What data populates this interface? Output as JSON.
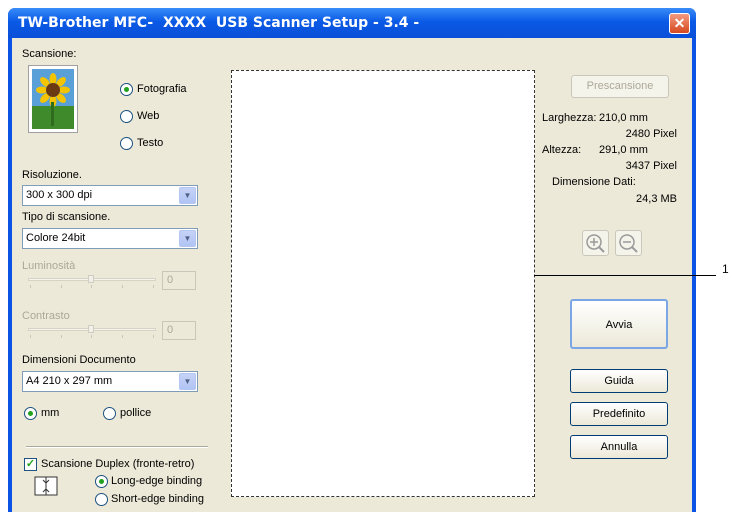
{
  "window": {
    "title": "TW-Brother MFC-  XXXX  USB Scanner Setup - 3.4 -",
    "close_glyph": "✕"
  },
  "scan": {
    "label": "Scansione:",
    "thumbnail_icon": "sunflower-photo-icon",
    "options": [
      {
        "label": "Fotografia",
        "selected": true
      },
      {
        "label": "Web",
        "selected": false
      },
      {
        "label": "Testo",
        "selected": false
      }
    ]
  },
  "resolution": {
    "label": "Risoluzione.",
    "value": "300 x 300 dpi"
  },
  "scan_type": {
    "label": "Tipo di scansione.",
    "value": "Colore 24bit"
  },
  "brightness": {
    "label": "Luminosità",
    "value": "0"
  },
  "contrast": {
    "label": "Contrasto",
    "value": "0"
  },
  "doc_size": {
    "label": "Dimensioni Documento",
    "value": "A4 210 x 297 mm"
  },
  "units": [
    {
      "label": "mm",
      "selected": true
    },
    {
      "label": "pollice",
      "selected": false
    }
  ],
  "duplex": {
    "label": "Scansione Duplex (fronte-retro)",
    "checked": true,
    "options": [
      {
        "label": "Long-edge binding",
        "selected": true
      },
      {
        "label": "Short-edge binding",
        "selected": false
      }
    ]
  },
  "right": {
    "prescan": "Prescansione",
    "width_label": "Larghezza:",
    "width_mm": "210,0 mm",
    "width_px": "2480 Pixel",
    "height_label": "Altezza:",
    "height_mm": "291,0 mm",
    "height_px": "3437 Pixel",
    "data_label": "Dimensione Dati:",
    "data_value": "24,3 MB",
    "start": "Avvia",
    "help": "Guida",
    "default": "Predefinito",
    "cancel": "Annulla"
  },
  "callout": "1",
  "colors": {
    "titlebar": "#0a5ae6",
    "dialog": "#ece9d8",
    "radio_dot": "#21a121"
  }
}
